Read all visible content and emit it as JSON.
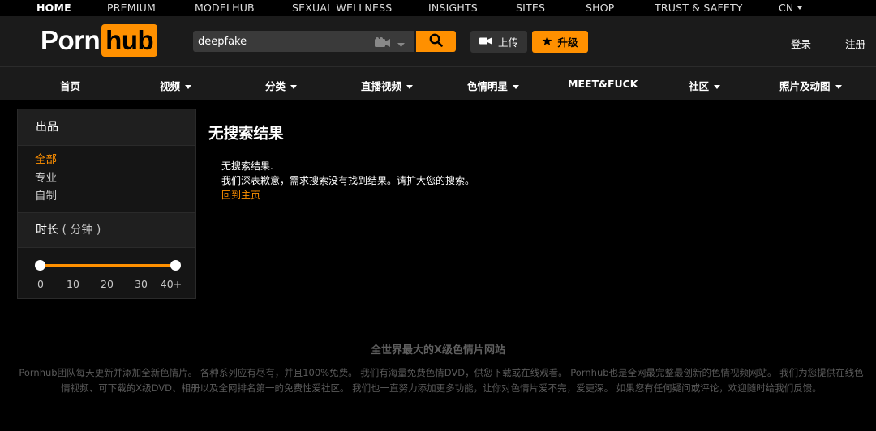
{
  "topbar": {
    "items": [
      "HOME",
      "PREMIUM",
      "MODELHUB",
      "SEXUAL WELLNESS",
      "INSIGHTS",
      "SITES",
      "SHOP",
      "TRUST & SAFETY",
      "CN"
    ]
  },
  "header": {
    "logo_left": "Porn",
    "logo_right": "hub",
    "search_value": "deepfake",
    "upload_label": "上传",
    "upgrade_label": "升级",
    "login_label": "登录",
    "register_label": "注册"
  },
  "nav": {
    "items": [
      "首页",
      "视频",
      "分类",
      "直播视频",
      "色情明星",
      "MEET&FUCK",
      "社区",
      "照片及动图"
    ]
  },
  "sidebar": {
    "production_title": "出品",
    "production_items": [
      "全部",
      "专业",
      "自制"
    ],
    "duration_title": "时长",
    "duration_unit": "( 分钟 )",
    "duration_ticks": [
      "0",
      "10",
      "20",
      "30",
      "40+"
    ],
    "duration_range": [
      0,
      1
    ]
  },
  "main": {
    "title": "无搜索结果",
    "line1": "无搜索结果.",
    "line2": "我们深表歉意，需求搜索没有找到结果。请扩大您的搜索。",
    "home_link": "回到主页"
  },
  "footer": {
    "title": "全世界最大的X级色情片网站",
    "text": "Pornhub团队每天更新并添加全新色情片。 各种系列应有尽有，并且100%免费。 我们有海量免费色情DVD，供您下载或在线观看。 Pornhub也是全网最完整最创新的色情视频网站。 我们为您提供在线色情视频、可下载的X级DVD、相册以及全网排名第一的免费性爱社区。 我们也一直努力添加更多功能，让你对色情片爱不完，爱更深。 如果您有任何疑问或评论，欢迎随时给我们反馈。"
  },
  "colors": {
    "accent": "#ff9000",
    "background": "#000000",
    "header_bg": "#1b1b1b"
  }
}
